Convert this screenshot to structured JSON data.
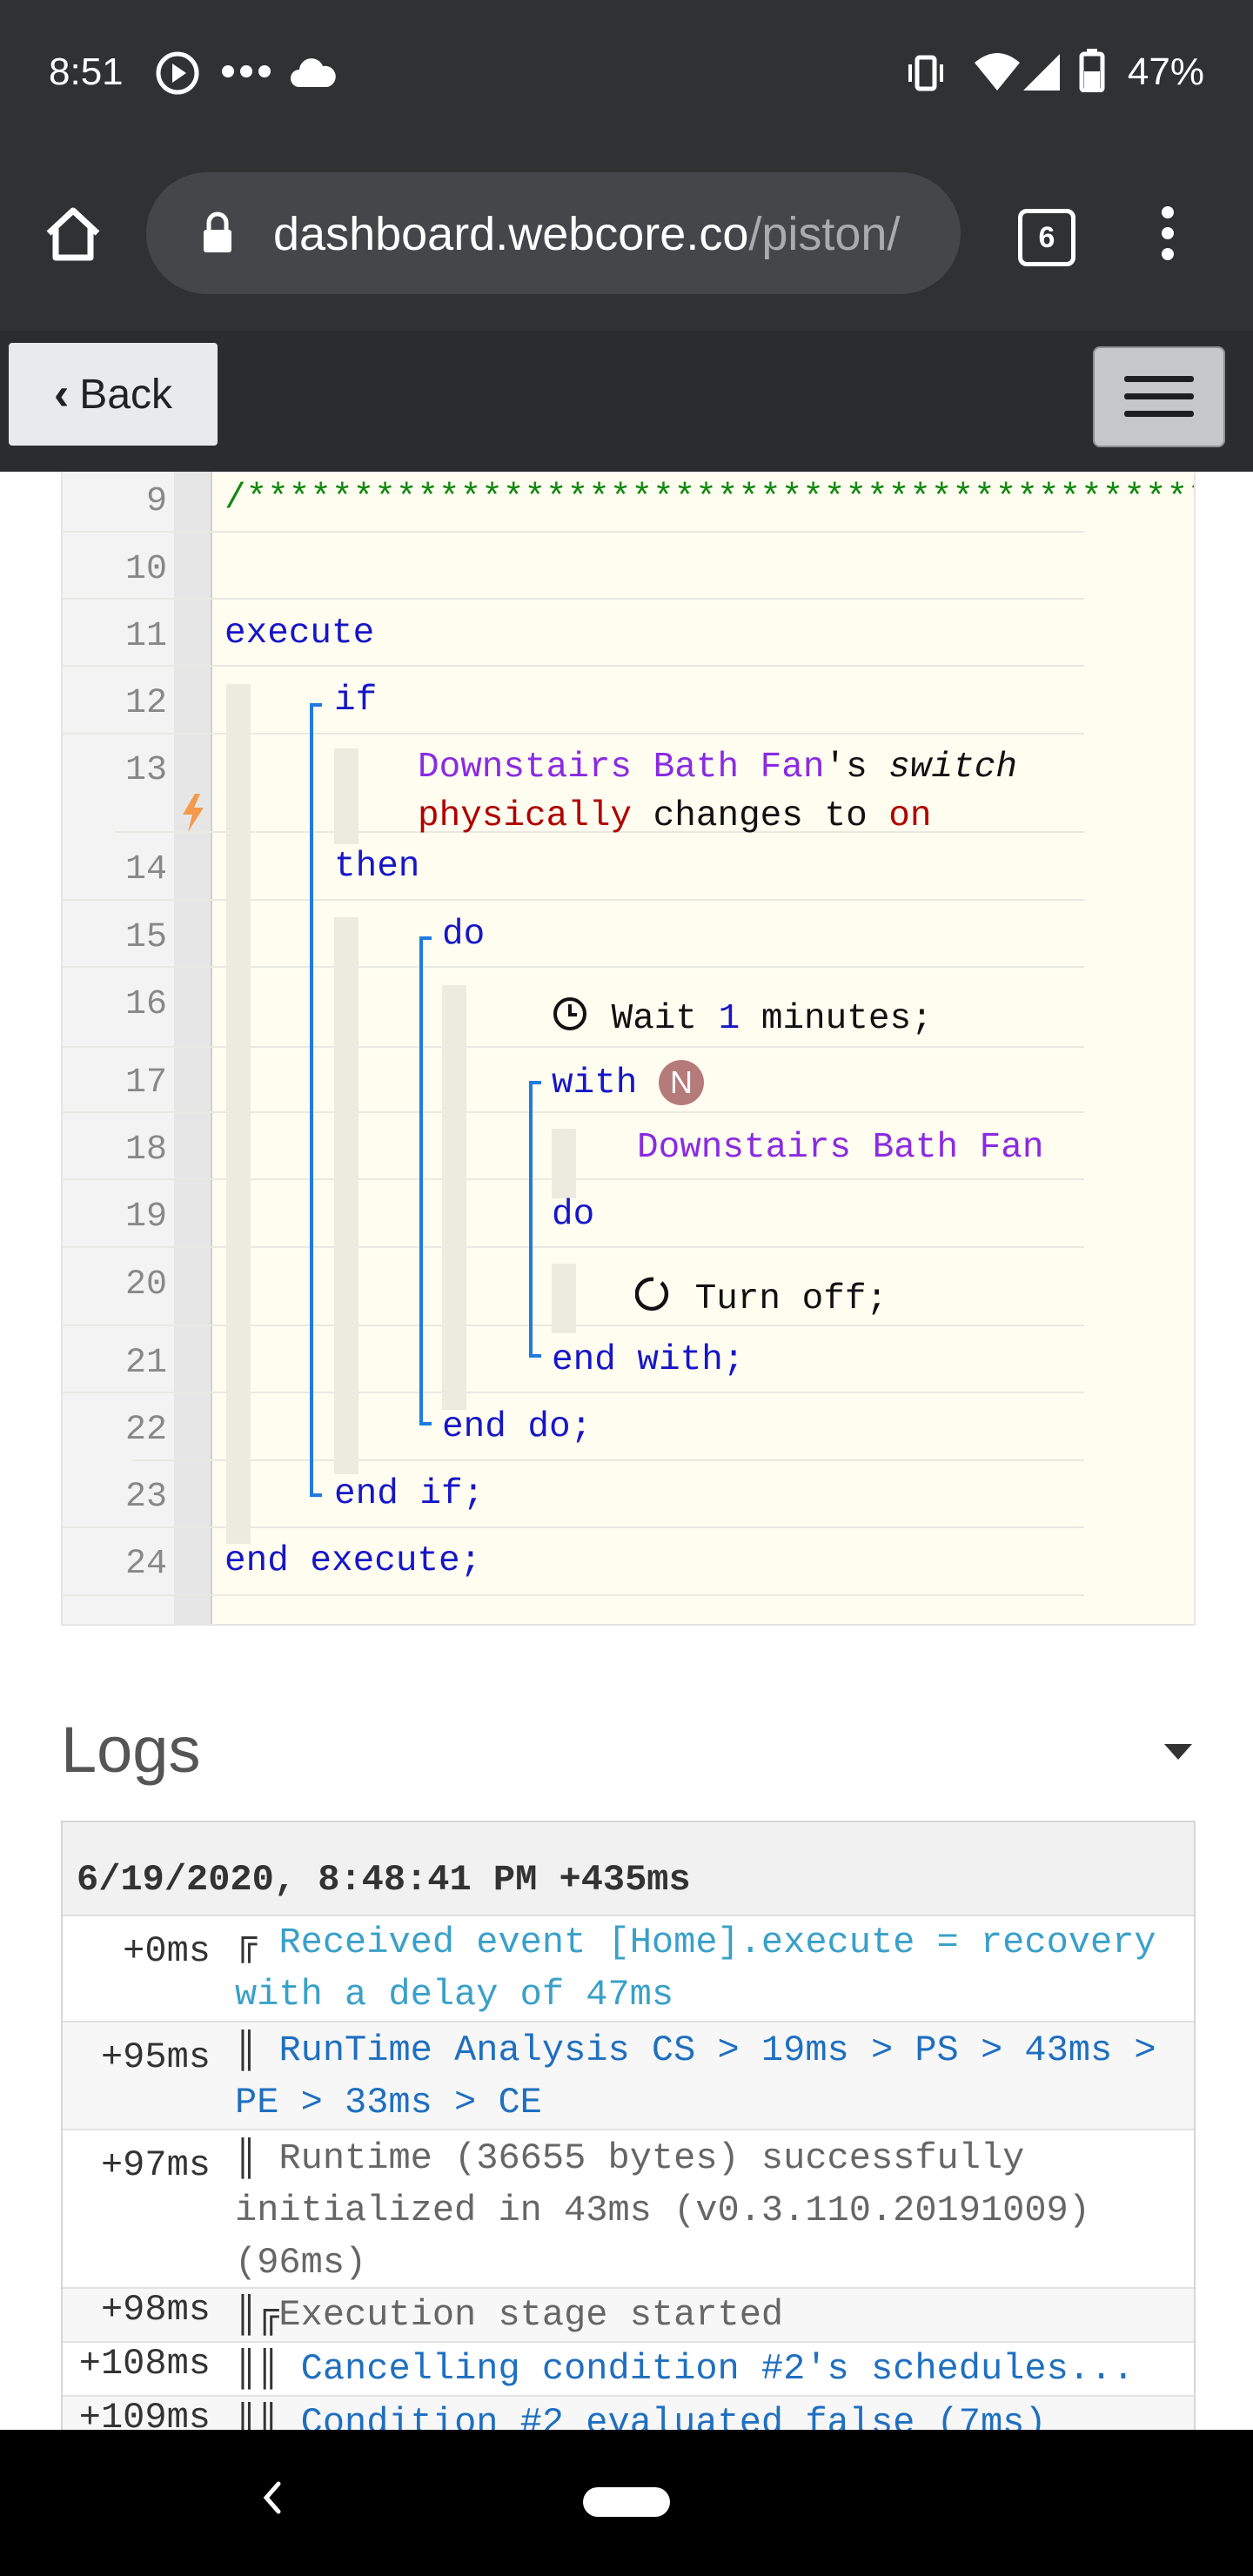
{
  "status_bar": {
    "time": "8:51",
    "battery": "47%"
  },
  "browser": {
    "url_host": "dashboard.webcore.co",
    "url_path": "/piston/",
    "tab_count": "6"
  },
  "toolbar": {
    "back_label": "Back"
  },
  "code": {
    "line_numbers": [
      "9",
      "10",
      "11",
      "12",
      "13",
      "14",
      "15",
      "16",
      "17",
      "18",
      "19",
      "20",
      "21",
      "22",
      "23",
      "24"
    ],
    "comment": "/*********************************************",
    "execute": "execute",
    "if": "if",
    "device1": "Downstairs Bath Fan",
    "apos_s": "'s ",
    "attr_switch": "switch",
    "physically": "physically",
    "changes_to": " changes to ",
    "on": "on",
    "then": "then",
    "do": "do",
    "wait": " Wait ",
    "wait_num": "1",
    "wait_unit": " minutes;",
    "with": "with",
    "badge": "N",
    "device2": "Downstairs Bath Fan",
    "do2": "do",
    "turn_off": " Turn off;",
    "end_with": "end with;",
    "end_do": "end do;",
    "end_if": "end if;",
    "end_execute": "end execute;"
  },
  "logs": {
    "title": "Logs",
    "header": "6/19/2020, 8:48:41 PM +435ms",
    "rows": [
      {
        "ts": "+0ms",
        "prefix": "╔",
        "msg": "Received event [Home].execute = recovery with a delay of 47ms"
      },
      {
        "ts": "+95ms",
        "prefix": "║",
        "msg": "RunTime Analysis CS > 19ms > PS > 43ms > PE > 33ms > CE"
      },
      {
        "ts": "+97ms",
        "prefix": "║",
        "msg": "Runtime (36655 bytes) successfully initialized in 43ms (v0.3.110.20191009) (96ms)"
      },
      {
        "ts": "+98ms",
        "prefix": "║╔",
        "msg": "Execution stage started"
      },
      {
        "ts": "+108ms",
        "prefix": "║║",
        "msg": "Cancelling condition #2's schedules..."
      },
      {
        "ts": "+109ms",
        "prefix": "║║",
        "msg": "Condition #2 evaluated false (7ms)"
      }
    ]
  }
}
